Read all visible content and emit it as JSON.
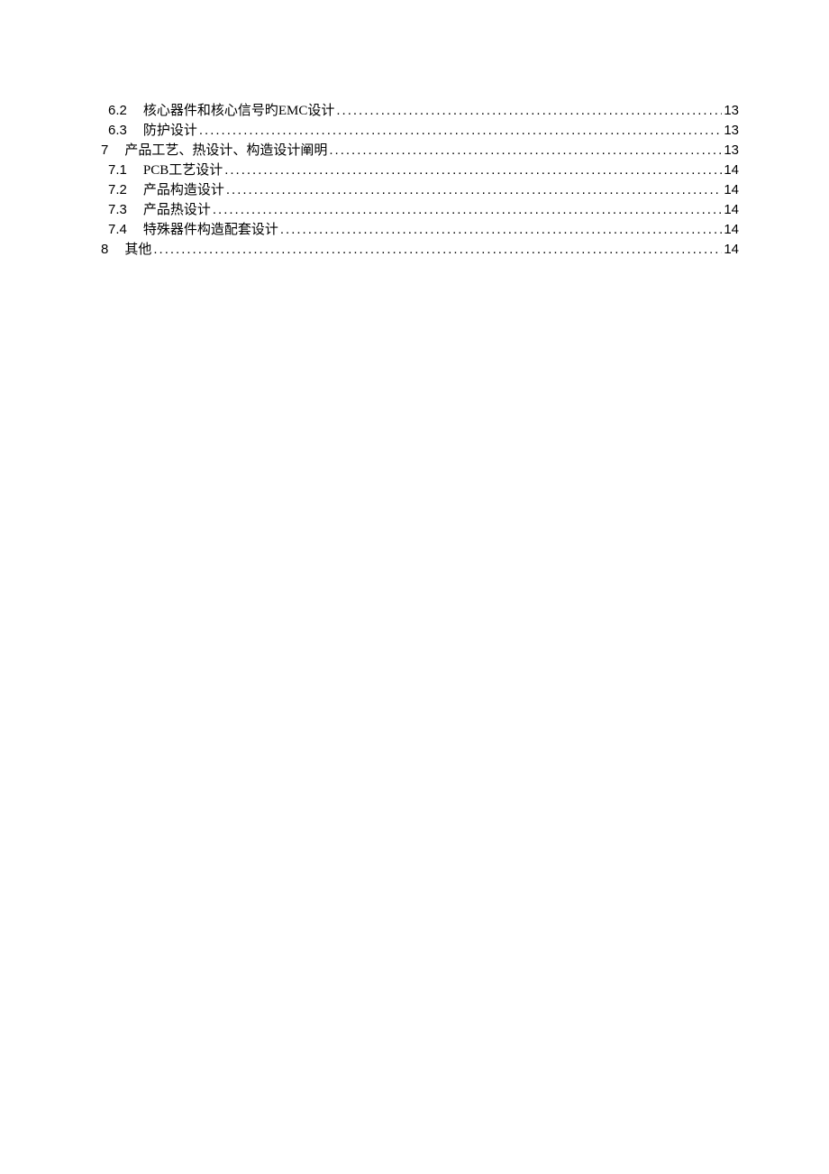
{
  "toc": {
    "entries": [
      {
        "level": 2,
        "number": "6.2",
        "title": "核心器件和核心信号旳EMC设计",
        "page": "13"
      },
      {
        "level": 2,
        "number": "6.3",
        "title": "防护设计",
        "page": "13"
      },
      {
        "level": 1,
        "number": "7",
        "title": "产品工艺、热设计、构造设计阐明",
        "page": "13"
      },
      {
        "level": 2,
        "number": "7.1",
        "title": "PCB工艺设计",
        "page": "14"
      },
      {
        "level": 2,
        "number": "7.2",
        "title": "产品构造设计",
        "page": "14"
      },
      {
        "level": 2,
        "number": "7.3",
        "title": "产品热设计",
        "page": "14"
      },
      {
        "level": 2,
        "number": "7.4",
        "title": "特殊器件构造配套设计",
        "page": "14"
      },
      {
        "level": 1,
        "number": "8",
        "title": "其他",
        "page": "14"
      }
    ]
  }
}
